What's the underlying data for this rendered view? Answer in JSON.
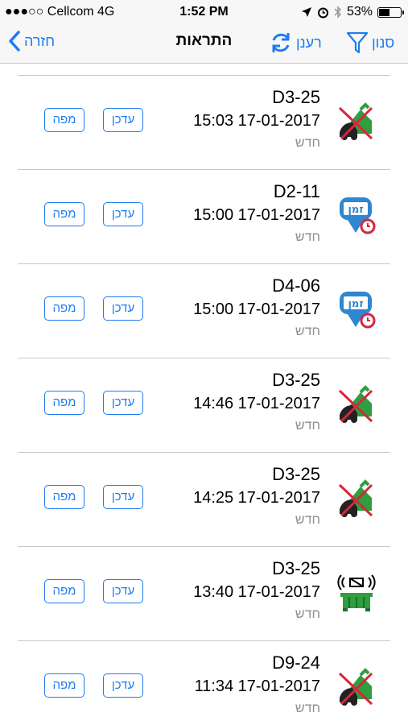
{
  "status_bar": {
    "carrier": "●●●○○ Cellcom  4G",
    "time": "1:52 PM",
    "battery": "53%",
    "battery_level": 0.53
  },
  "nav": {
    "back_label": "חזרה",
    "title": "התראות",
    "refresh_label": "רענן",
    "filter_label": "סנון"
  },
  "buttons": {
    "update": "עדכן",
    "map": "מפה"
  },
  "alerts": [
    {
      "code": "D3-25",
      "datetime": "15:03 17-01-2017",
      "status": "חדש",
      "icon": "no-access-truck-icon"
    },
    {
      "code": "D2-11",
      "datetime": "15:00 17-01-2017",
      "status": "חדש",
      "icon": "time-pin-icon",
      "icon_text": "זמן"
    },
    {
      "code": "D4-06",
      "datetime": "15:00 17-01-2017",
      "status": "חדש",
      "icon": "time-pin-icon",
      "icon_text": "זמן"
    },
    {
      "code": "D3-25",
      "datetime": "14:46 17-01-2017",
      "status": "חדש",
      "icon": "no-access-truck-icon"
    },
    {
      "code": "D3-25",
      "datetime": "14:25 17-01-2017",
      "status": "חדש",
      "icon": "no-access-truck-icon"
    },
    {
      "code": "D3-25",
      "datetime": "13:40 17-01-2017",
      "status": "חדש",
      "icon": "bin-signal-icon"
    },
    {
      "code": "D9-24",
      "datetime": "11:34 17-01-2017",
      "status": "חדש",
      "icon": "no-access-truck-icon"
    }
  ],
  "colors": {
    "accent": "#1e7cf2",
    "icon_green": "#2e9e3e",
    "icon_red": "#d7263d",
    "pin_blue": "#2f86d1"
  }
}
